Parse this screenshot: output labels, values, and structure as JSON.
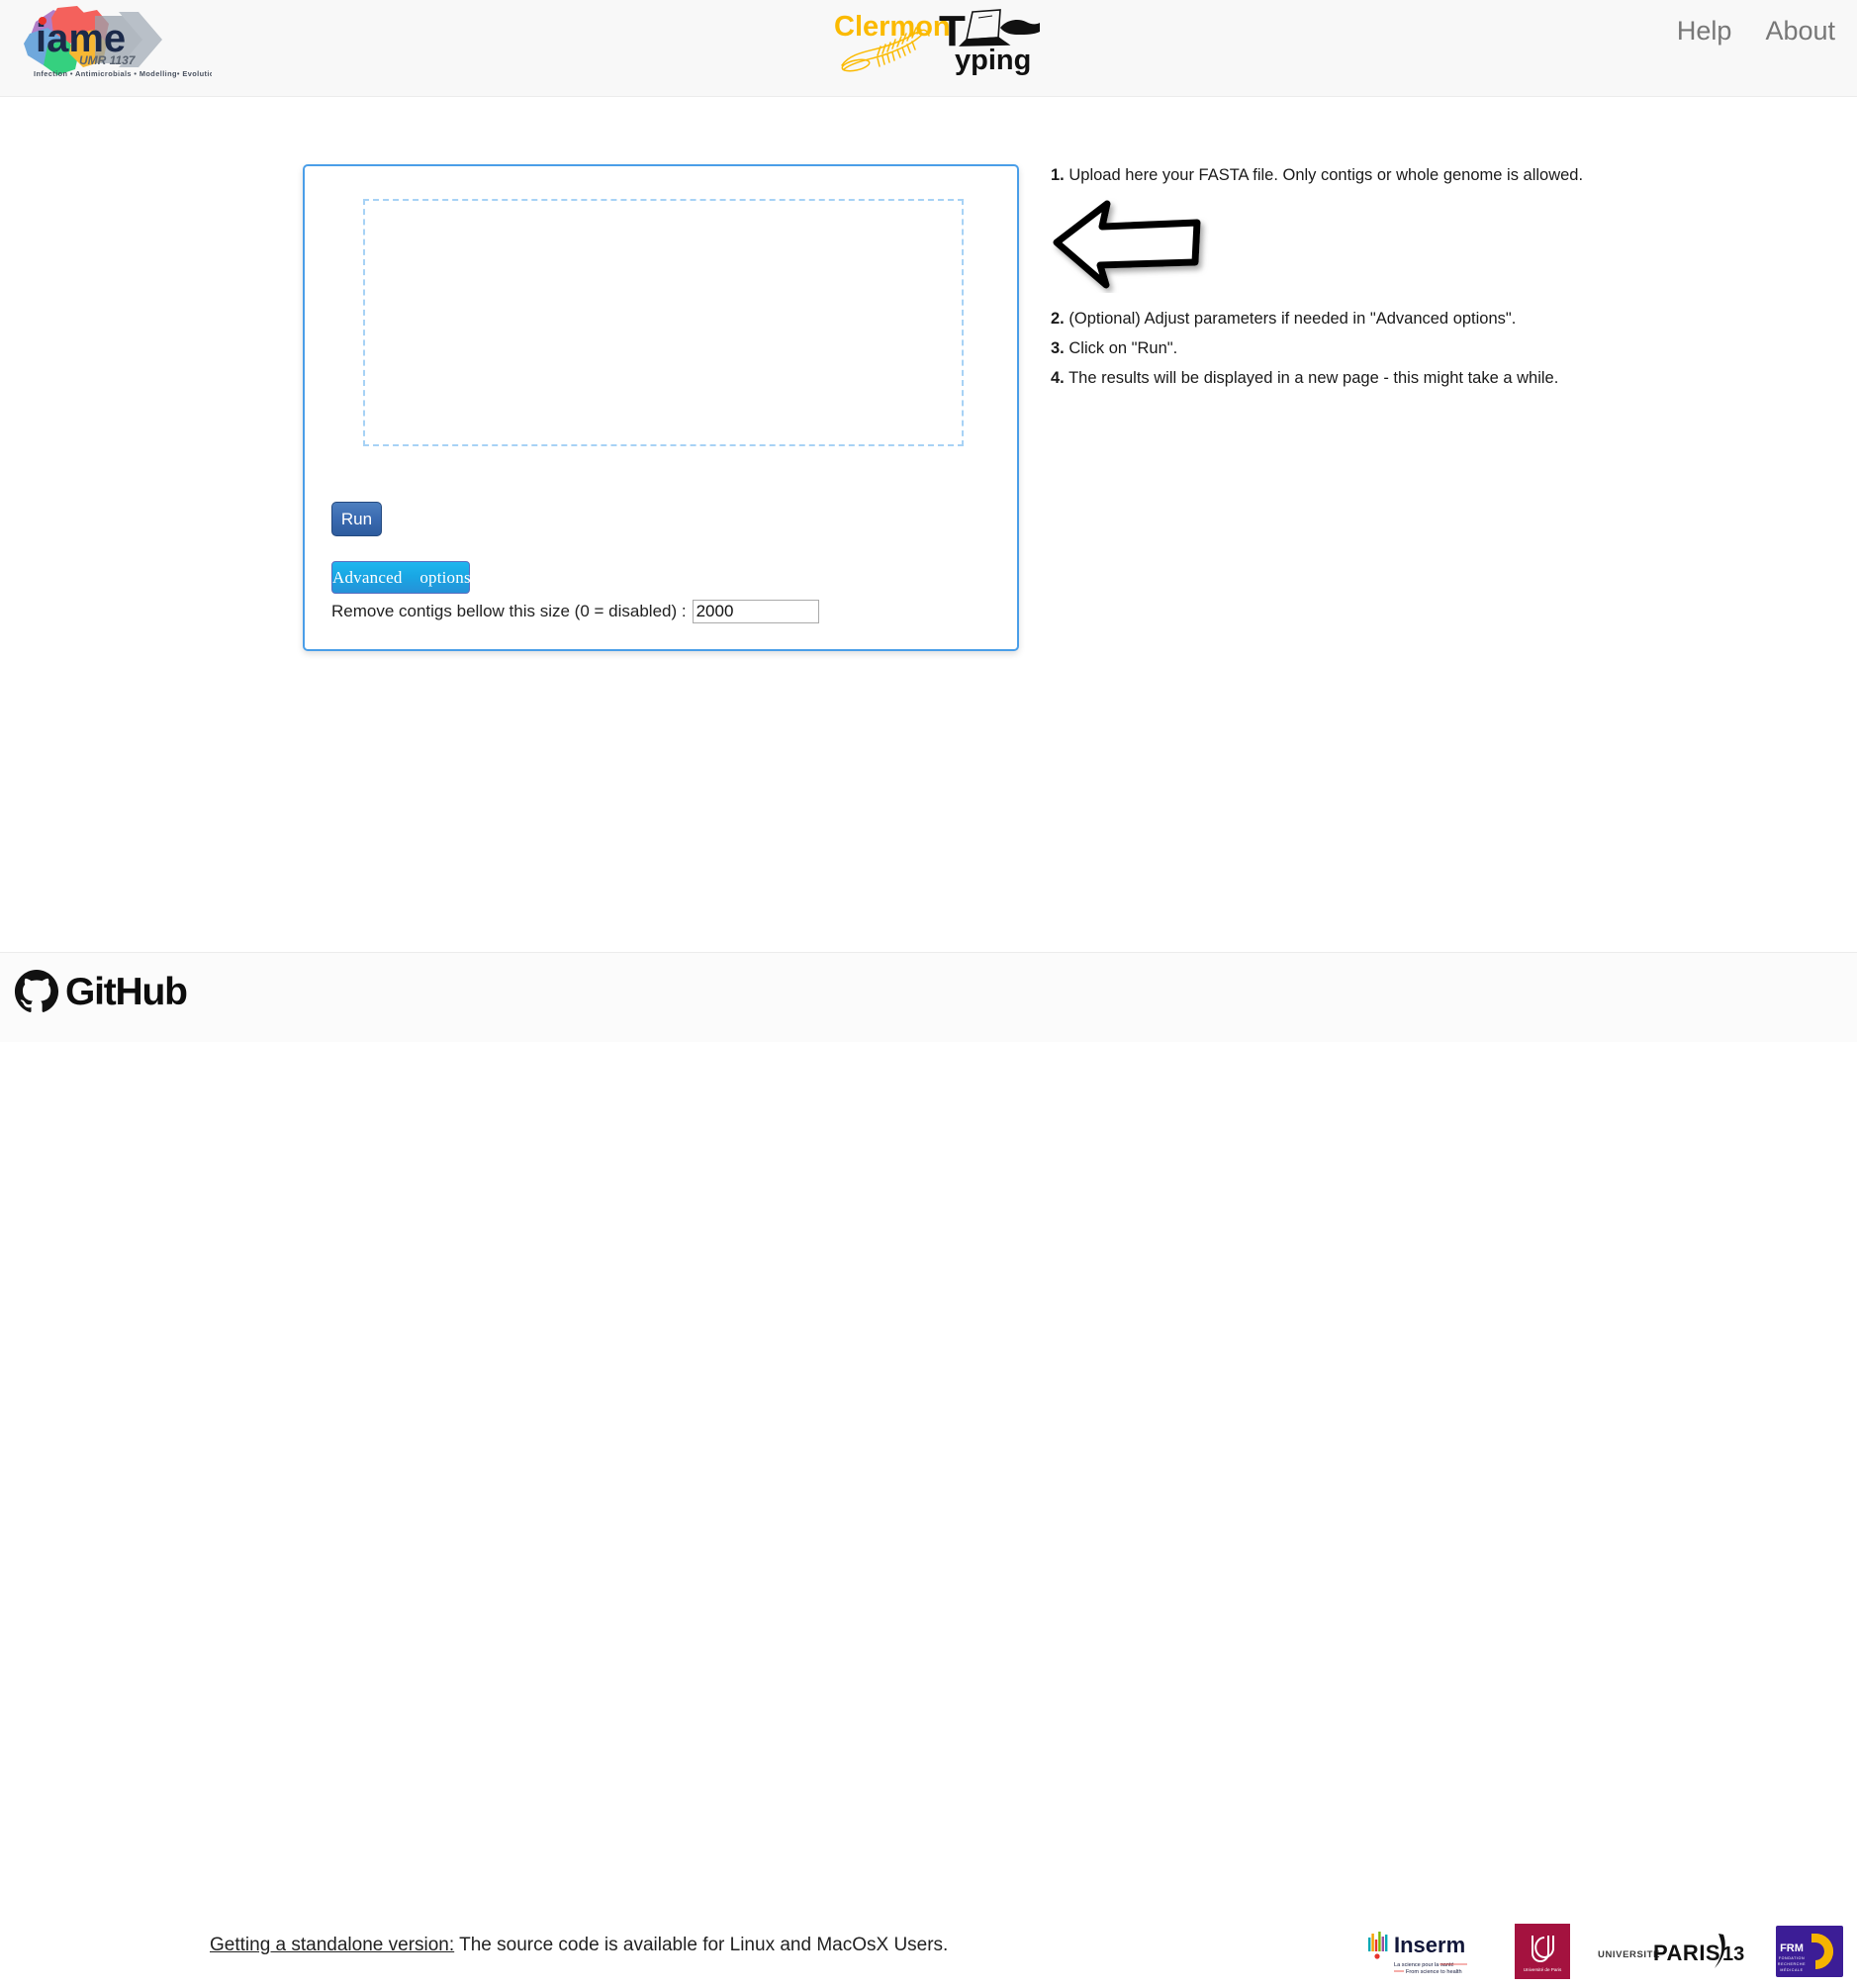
{
  "header": {
    "left_logo": {
      "name": "iame",
      "wordmark": "iame",
      "sub": "UMR 1137",
      "tagline": "Infection • Antimicrobials • Modelling • Evolution"
    },
    "center_logo": {
      "part1": "Clermon",
      "part2_initial": "T",
      "part2_rest": "yping"
    },
    "nav": [
      {
        "label": "Help"
      },
      {
        "label": "About"
      }
    ]
  },
  "main": {
    "upload_panel": {
      "dropzone_text": "",
      "run_label": "Run",
      "advanced_label": "Advanced    options",
      "contig_label": "Remove contigs bellow this size (0 = disabled) :",
      "contig_value": "2000",
      "contig_placeholder": ""
    },
    "instructions": [
      {
        "num": "1.",
        "text": "Upload here your FASTA file. Only contigs or whole genome is allowed."
      },
      {
        "num": "2.",
        "text": "(Optional) Adjust parameters if needed in \"Advanced options\"."
      },
      {
        "num": "3.",
        "text": "Click on \"Run\"."
      },
      {
        "num": "4.",
        "text": "The results will be displayed in a new page - this might take a while."
      }
    ],
    "arrow_icon": "left-arrow-icon"
  },
  "footer": {
    "github_word": "GitHub",
    "standalone_link": "Getting a standalone version:",
    "standalone_text": " The source code is available for Linux and MacOsX Users.",
    "partners": [
      {
        "name": "Inserm",
        "word": "Inserm",
        "tag_fr": "La science pour la santé",
        "tag_en": "From science to health"
      },
      {
        "name": "Université de Paris",
        "word": "Université de Paris"
      },
      {
        "name": "Université Paris 13",
        "pre": "UNIVERSITÉ",
        "word": "PARIS",
        "num": "13"
      },
      {
        "name": "FRM",
        "word": "FRM",
        "sub1": "FONDATION",
        "sub2": "RECHERCHE",
        "sub3": "MÉDICALE"
      }
    ]
  },
  "colors": {
    "panel_border": "#4a9ee8",
    "dropzone_border": "#a7d2f5",
    "run_button": "#2e5c9e",
    "advanced_button": "#19a7e4",
    "logo_yellow": "#fbba00",
    "updp_red": "#a4123f",
    "frm_purple": "#3c1d96",
    "frm_yellow": "#f5b400"
  }
}
